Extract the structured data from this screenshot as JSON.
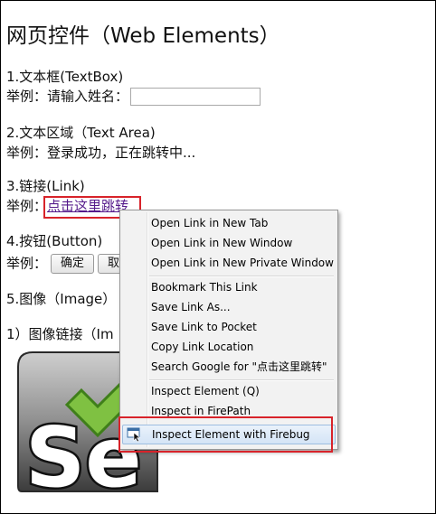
{
  "page": {
    "title": "网页控件（Web Elements）",
    "textbox_heading": "1.文本框(TextBox)",
    "textbox_prefix": "举例：请输入姓名：",
    "textarea_heading": "2.文本区域（Text Area)",
    "textarea_example": "举例：登录成功，正在跳转中...",
    "link_heading": "3.链接(Link)",
    "link_prefix": "举例：",
    "link_text": "点击这里跳转",
    "button_heading": "4.按钮(Button)",
    "button_prefix": "举例：",
    "confirm_button": "确定",
    "second_button": "取",
    "image_heading": "5.图像（Image）",
    "image_link_heading": "1）图像链接（Im"
  },
  "context_menu": {
    "items": [
      {
        "label": "Open Link in New Tab"
      },
      {
        "label": "Open Link in New Window"
      },
      {
        "label": "Open Link in New Private Window"
      },
      {
        "label": "Bookmark This Link"
      },
      {
        "label": "Save Link As..."
      },
      {
        "label": "Save Link to Pocket"
      },
      {
        "label": "Copy Link Location"
      },
      {
        "label": "Search Google for \"点击这里跳转\""
      },
      {
        "label": "Inspect Element (Q)"
      },
      {
        "label": "Inspect in FirePath"
      },
      {
        "label": "Inspect Element with Firebug",
        "icon": "firebug-inspect-icon",
        "highlighted": true
      }
    ]
  },
  "colors": {
    "highlight_border": "#d8232a",
    "link": "#551a8b",
    "menu_bg": "#f2f2f2",
    "logo_green": "#7fc142"
  },
  "logo": {
    "text": "Se",
    "icon": "selenium-logo"
  }
}
